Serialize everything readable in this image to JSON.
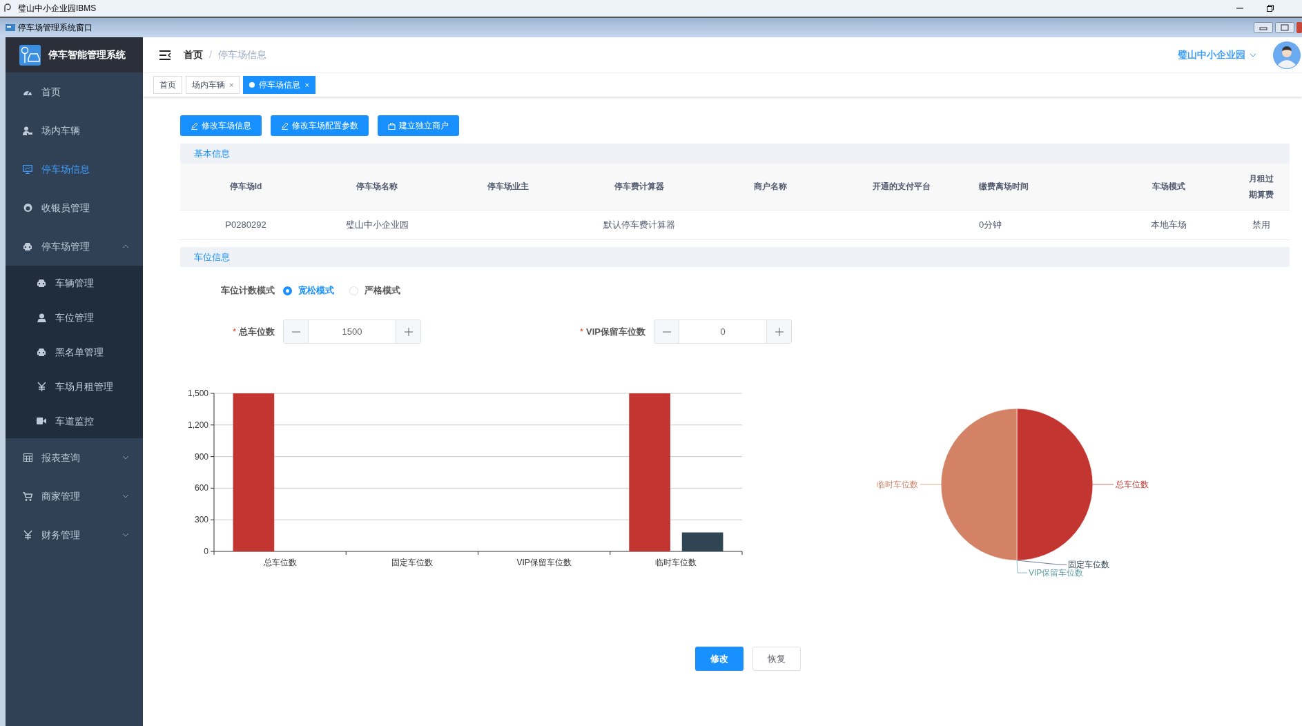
{
  "os_window": {
    "title": "璧山中小企业园IBMS"
  },
  "app_window": {
    "title": "停车场管理系统窗口"
  },
  "sidebar": {
    "title": "停车智能管理系统",
    "items": [
      {
        "label": "首页",
        "selected": false
      },
      {
        "label": "场内车辆",
        "selected": false
      },
      {
        "label": "停车场信息",
        "selected": true
      },
      {
        "label": "收银员管理",
        "selected": false
      },
      {
        "label": "停车场管理",
        "selected": false,
        "expanded": true,
        "children": [
          {
            "label": "车辆管理",
            "selected": false
          },
          {
            "label": "车位管理",
            "selected": false
          },
          {
            "label": "黑名单管理",
            "selected": false
          },
          {
            "label": "车场月租管理",
            "selected": false
          },
          {
            "label": "车道监控",
            "selected": false
          }
        ]
      },
      {
        "label": "报表查询",
        "selected": false,
        "expanded": false
      },
      {
        "label": "商家管理",
        "selected": false,
        "expanded": false
      },
      {
        "label": "财务管理",
        "selected": false,
        "expanded": false
      }
    ]
  },
  "header": {
    "breadcrumb": [
      "首页",
      "停车场信息"
    ],
    "separator": "/",
    "user": "璧山中小企业园"
  },
  "tabs": [
    {
      "label": "首页",
      "selected": false
    },
    {
      "label": "场内车辆",
      "selected": false,
      "close": "×"
    },
    {
      "label": "停车场信息",
      "selected": true,
      "close": "×"
    }
  ],
  "actions": [
    "修改车场信息",
    "修改车场配置参数",
    "建立独立商户"
  ],
  "basic_info": {
    "title": "基本信息",
    "columns": [
      "停车场Id",
      "停车场名称",
      "停车场业主",
      "停车费计算器",
      "商户名称",
      "开通的支付平台",
      "缴费离场时间",
      "车场模式",
      "月租过期算费"
    ],
    "rows": [
      [
        "P0280292",
        "璧山中小企业园",
        null,
        "默认停车费计算器",
        null,
        null,
        "0分钟",
        "本地车场",
        "禁用"
      ]
    ]
  },
  "space_info": {
    "title": "车位信息",
    "count_mode": {
      "label": "车位计数模式",
      "options": [
        {
          "label": "宽松模式",
          "selected": true
        },
        {
          "label": "严格模式",
          "selected": false
        }
      ]
    },
    "fields": [
      {
        "label": "总车位数",
        "required_mark": "*",
        "value": "1500"
      },
      {
        "label": "VIP保留车位数",
        "required_mark": "*",
        "value": "0"
      }
    ],
    "bar_chart": {
      "chart_data": {
        "type": "bar",
        "categories": [
          "总车位数",
          "固定车位数",
          "VIP保留车位数",
          "临时车位数"
        ],
        "series": [
          {
            "color": "#c23531",
            "values": [
              1500,
              0,
              0,
              1500
            ]
          },
          {
            "color": "#2f4554",
            "values": [
              0,
              0,
              0,
              180
            ]
          }
        ],
        "grid": true,
        "ylim": [
          0,
          1500
        ],
        "yticks": [
          0,
          {
            "value": 300,
            "label": "300"
          },
          {
            "value": 600,
            "label": "600"
          },
          {
            "value": 900,
            "label": "900"
          },
          {
            "value": 1200,
            "label": "1,200"
          },
          {
            "value": 1500,
            "label": "1,500"
          }
        ]
      }
    },
    "pie_chart": {
      "chart_data": {
        "type": "pie",
        "categories": [
          "总车位数",
          "固定车位数",
          "VIP保留车位数",
          "临时车位数"
        ],
        "values": [
          50,
          0,
          0,
          50
        ],
        "colors": [
          "#c23531",
          "#2f4554",
          "#61a0a8",
          "#d48265"
        ]
      }
    }
  },
  "footer_buttons": [
    {
      "label": "修改",
      "kind": "primary"
    },
    {
      "label": "恢复",
      "kind": "default"
    }
  ]
}
